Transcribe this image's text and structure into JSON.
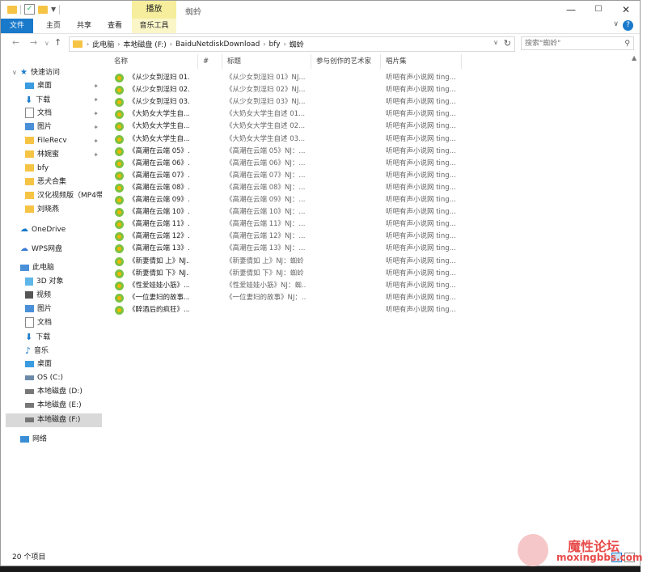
{
  "window": {
    "title": "蜘蛉",
    "context_tab": "播放",
    "controls": [
      "—",
      "☐",
      "✕"
    ]
  },
  "ribbon": {
    "tabs": [
      "文件",
      "主页",
      "共享",
      "查看",
      "音乐工具"
    ]
  },
  "address": {
    "crumbs": [
      "此电脑",
      "本地磁盘 (F:)",
      "BaiduNetdiskDownload",
      "bfy",
      "蜘蛉"
    ],
    "search_placeholder": "搜索\"蜘蛉\""
  },
  "nav": {
    "quick_access": "快速访问",
    "pinned": [
      "桌面",
      "下载",
      "文档",
      "图片",
      "FileRecv",
      "林婉蜜"
    ],
    "recent": [
      "bfy",
      "恶犬合集",
      "汉化视频版（MP4带",
      "刘晓燕"
    ],
    "onedrive": "OneDrive",
    "wps": "WPS网盘",
    "this_pc": "此电脑",
    "pc_items": [
      "3D 对象",
      "视频",
      "图片",
      "文档",
      "下载",
      "音乐",
      "桌面",
      "OS (C:)",
      "本地磁盘 (D:)",
      "本地磁盘 (E:)",
      "本地磁盘 (F:)"
    ],
    "network": "网络"
  },
  "columns": [
    "名称",
    "#",
    "标题",
    "参与创作的艺术家",
    "唱片集"
  ],
  "files": [
    {
      "name": "《从少女到淫妇 01...",
      "title": "《从少女到淫妇 01》NJ...",
      "album": "听吧有声小说网 ting..."
    },
    {
      "name": "《从少女到淫妇 02...",
      "title": "《从少女到淫妇 02》NJ...",
      "album": "听吧有声小说网 ting..."
    },
    {
      "name": "《从少女到淫妇 03...",
      "title": "《从少女到淫妇 03》NJ...",
      "album": "听吧有声小说网 ting..."
    },
    {
      "name": "《大奶女大学生自...",
      "title": "《大奶女大学生自述 01...",
      "album": "听吧有声小说网 ting..."
    },
    {
      "name": "《大奶女大学生自...",
      "title": "《大奶女大学生自述 02...",
      "album": "听吧有声小说网 ting..."
    },
    {
      "name": "《大奶女大学生自...",
      "title": "《大奶女大学生自述 03...",
      "album": "听吧有声小说网 ting..."
    },
    {
      "name": "《高潮在云端 05》...",
      "title": "《高潮在云端 05》NJ：...",
      "album": "听吧有声小说网 ting..."
    },
    {
      "name": "《高潮在云端 06》...",
      "title": "《高潮在云端 06》NJ：...",
      "album": "听吧有声小说网 ting..."
    },
    {
      "name": "《高潮在云端 07》...",
      "title": "《高潮在云端 07》NJ：...",
      "album": "听吧有声小说网 ting..."
    },
    {
      "name": "《高潮在云端 08》...",
      "title": "《高潮在云端 08》NJ：...",
      "album": "听吧有声小说网 ting..."
    },
    {
      "name": "《高潮在云端 09》...",
      "title": "《高潮在云端 09》NJ：...",
      "album": "听吧有声小说网 ting..."
    },
    {
      "name": "《高潮在云端 10》...",
      "title": "《高潮在云端 10》NJ：...",
      "album": "听吧有声小说网 ting..."
    },
    {
      "name": "《高潮在云端 11》...",
      "title": "《高潮在云端 11》NJ：...",
      "album": "听吧有声小说网 ting..."
    },
    {
      "name": "《高潮在云端 12》...",
      "title": "《高潮在云端 12》NJ：...",
      "album": "听吧有声小说网 ting..."
    },
    {
      "name": "《高潮在云端 13》...",
      "title": "《高潮在云端 13》NJ：...",
      "album": "听吧有声小说网 ting..."
    },
    {
      "name": "《新妻倩如 上》NJ...",
      "title": "《新妻倩如 上》NJ：蜘蛉",
      "album": "听吧有声小说网 ting..."
    },
    {
      "name": "《新妻倩如 下》NJ...",
      "title": "《新妻倩如 下》NJ：蜘蛉",
      "album": "听吧有声小说网 ting..."
    },
    {
      "name": "《性爱娃娃小筋》...",
      "title": "《性爱娃娃小筋》NJ：蜘...",
      "album": "听吧有声小说网 ting..."
    },
    {
      "name": "《一位妻妇的故事...",
      "title": "《一位妻妇的故事》NJ：...",
      "album": "听吧有声小说网 ting..."
    },
    {
      "name": "《醉酒后的疯狂》...",
      "title": "",
      "album": "听吧有声小说网 ting..."
    }
  ],
  "status": {
    "count": "20 个项目"
  },
  "watermark": {
    "line1": "魔性论坛",
    "line2": "moxingbbs.com"
  },
  "colors": {
    "accent": "#1979ca",
    "context_tab": "#f6ee9c",
    "selected_nav": "#d9d9d9"
  }
}
